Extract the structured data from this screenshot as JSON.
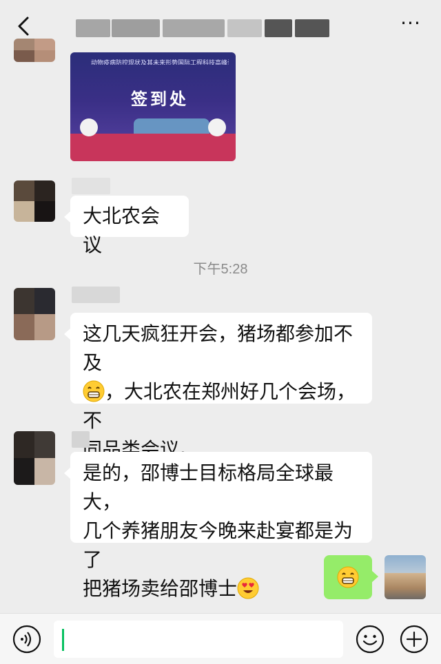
{
  "header": {
    "title": "",
    "back_icon": "chevron-left-icon",
    "more_label": "···"
  },
  "messages": {
    "image_message": {
      "banner_text": "签到处",
      "banner_subtitle": "动物疫病防控现状及其未来形势国际工程科技高峰论坛"
    },
    "msg1": {
      "text": "大北农会议"
    },
    "timestamp": "下午5:28",
    "msg2": {
      "line1": "这几天疯狂开会，猪场都参加不及",
      "line2_after_emoji": "，大北农在郑州好几个会场，不",
      "line3": "同品类会议。",
      "emoji": "grinning-face-emoji"
    },
    "msg3": {
      "line1": "是的，邵博士目标格局全球最大，",
      "line2": "几个养猪朋友今晚来赴宴都是为了",
      "line3": "把猪场卖给邵博士",
      "emoji": "heart-eyes-emoji"
    },
    "msg4": {
      "emoji": "grinning-face-emoji"
    }
  },
  "input_bar": {
    "input_value": "",
    "voice_icon": "voice-icon",
    "emoji_icon": "emoji-icon",
    "plus_icon": "plus-icon"
  },
  "colors": {
    "background": "#ededed",
    "bubble_white": "#ffffff",
    "bubble_green": "#95ec69",
    "caret": "#07c160"
  }
}
